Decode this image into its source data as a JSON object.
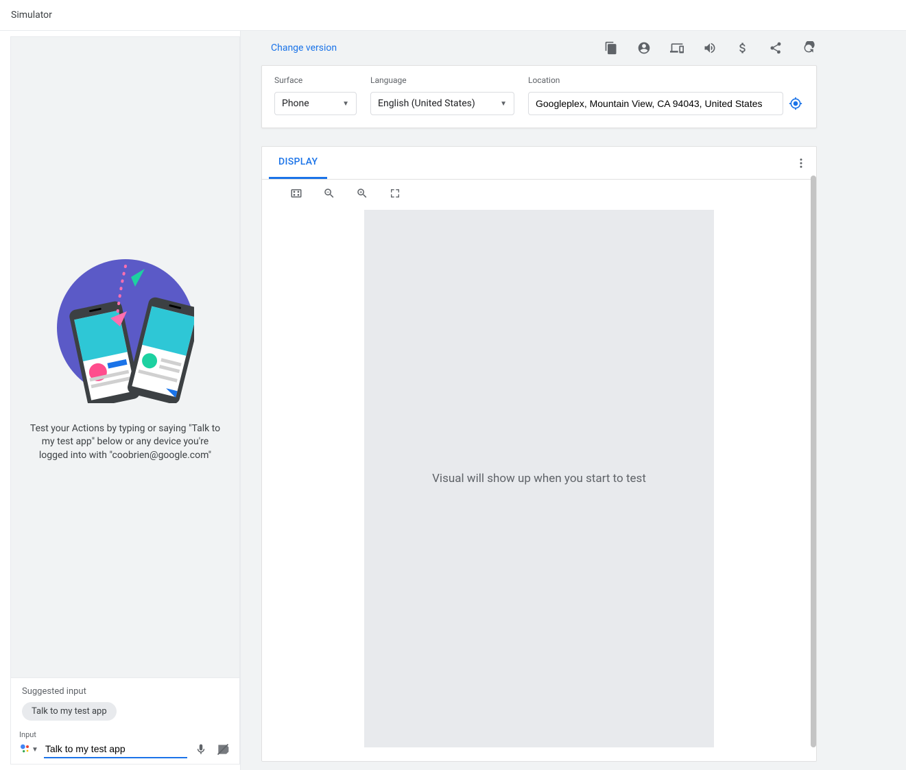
{
  "page": {
    "title": "Simulator"
  },
  "left": {
    "intro_text": "Test your Actions by typing or saying \"Talk to my test app\" below or any device you're logged into with \"coobrien@google.com\"",
    "suggested_label": "Suggested input",
    "suggested_chip": "Talk to my test app",
    "input_label": "Input",
    "input_value": "Talk to my test app"
  },
  "right": {
    "change_version": "Change version",
    "settings": {
      "surface_label": "Surface",
      "surface_value": "Phone",
      "language_label": "Language",
      "language_value": "English (United States)",
      "location_label": "Location",
      "location_value": "Googleplex, Mountain View, CA 94043, United States"
    },
    "display": {
      "tab_label": "DISPLAY",
      "placeholder": "Visual will show up when you start to test"
    }
  }
}
